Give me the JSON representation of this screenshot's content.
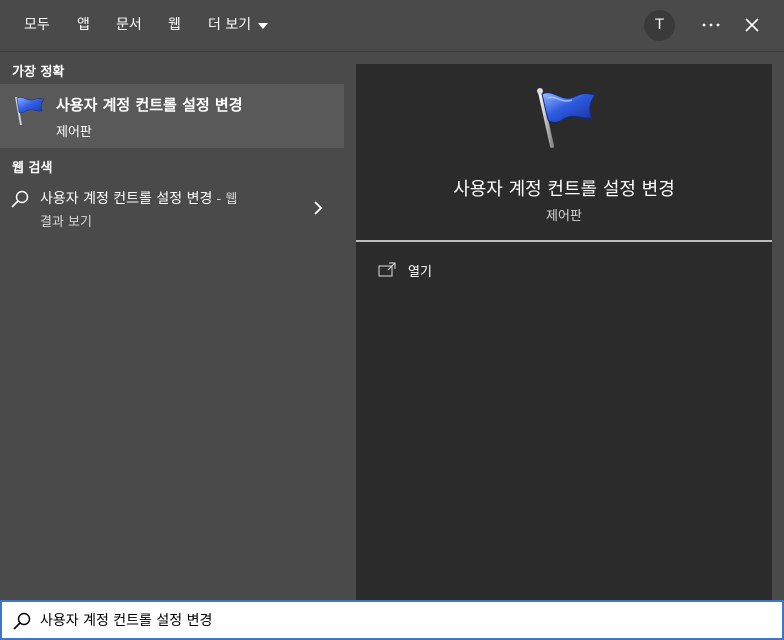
{
  "tabs": [
    {
      "label": "모두"
    },
    {
      "label": "앱"
    },
    {
      "label": "문서"
    },
    {
      "label": "웹"
    },
    {
      "label": "더 보기"
    }
  ],
  "header": {
    "avatar_initial": "T",
    "more_icon": "ellipsis-icon",
    "close_icon": "close-icon"
  },
  "best_match": {
    "section_label": "가장 정확",
    "title": "사용자 계정 컨트롤 설정 변경",
    "subtitle": "제어판",
    "icon": "blue-flag-icon"
  },
  "web_search": {
    "section_label": "웹 검색",
    "title": "사용자 계정 컨트롤 설정 변경",
    "suffix": " - 웹",
    "subtitle": "결과 보기",
    "icon": "search-icon"
  },
  "detail": {
    "title": "사용자 계정 컨트롤 설정 변경",
    "subtitle": "제어판",
    "icon": "blue-flag-icon",
    "actions": [
      {
        "label": "열기",
        "icon": "open-window-icon"
      }
    ]
  },
  "search": {
    "value": "사용자 계정 컨트롤 설정 변경",
    "icon": "search-icon"
  },
  "colors": {
    "pane_bg": "#4a4a4a",
    "selected_bg": "#595959",
    "detail_bg": "#2b2b2b",
    "search_border": "#3a78c9"
  }
}
